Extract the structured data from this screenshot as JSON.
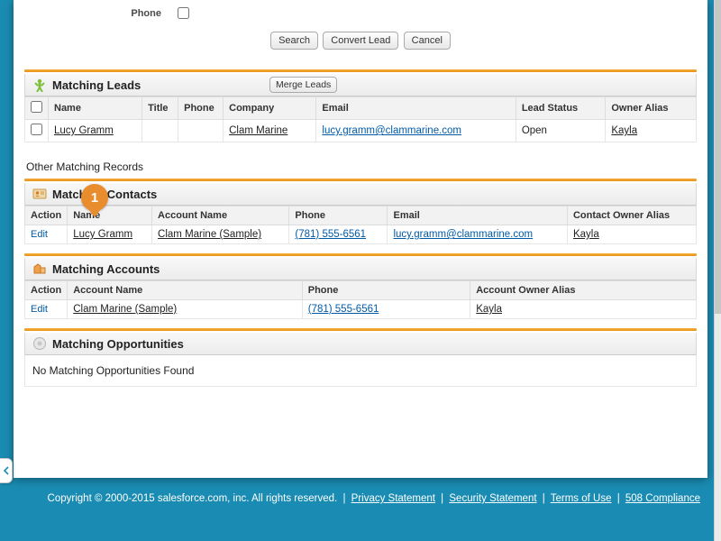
{
  "filter": {
    "phone_label": "Phone"
  },
  "buttons": {
    "search": "Search",
    "convert": "Convert Lead",
    "cancel": "Cancel",
    "merge_leads": "Merge Leads"
  },
  "other_label": "Other Matching Records",
  "leads": {
    "title": "Matching Leads",
    "headers": {
      "name": "Name",
      "title": "Title",
      "phone": "Phone",
      "company": "Company",
      "email": "Email",
      "status": "Lead Status",
      "owner": "Owner Alias"
    },
    "rows": [
      {
        "name": "Lucy Gramm",
        "title": "",
        "phone": "",
        "company": "Clam Marine",
        "email": "lucy.gramm@clammarine.com",
        "status": "Open",
        "owner": "Kayla"
      }
    ]
  },
  "contacts": {
    "title": "Matching Contacts",
    "headers": {
      "action": "Action",
      "name": "Name",
      "account": "Account Name",
      "phone": "Phone",
      "email": "Email",
      "owner": "Contact Owner Alias"
    },
    "rows": [
      {
        "action": "Edit",
        "name": "Lucy Gramm",
        "account": "Clam Marine (Sample)",
        "phone": "(781) 555-6561",
        "email": "lucy.gramm@clammarine.com",
        "owner": "Kayla"
      }
    ]
  },
  "accounts": {
    "title": "Matching Accounts",
    "headers": {
      "action": "Action",
      "account": "Account Name",
      "phone": "Phone",
      "owner": "Account Owner Alias"
    },
    "rows": [
      {
        "action": "Edit",
        "account": "Clam Marine (Sample)",
        "phone": "(781) 555-6561",
        "owner": "Kayla"
      }
    ]
  },
  "opps": {
    "title": "Matching Opportunities",
    "empty": "No Matching Opportunities Found"
  },
  "footer": {
    "copyright": "Copyright © 2000-2015 salesforce.com, inc. All rights reserved.",
    "privacy": "Privacy Statement",
    "security": "Security Statement",
    "terms": "Terms of Use",
    "compliance": "508 Compliance"
  },
  "marker": "1"
}
